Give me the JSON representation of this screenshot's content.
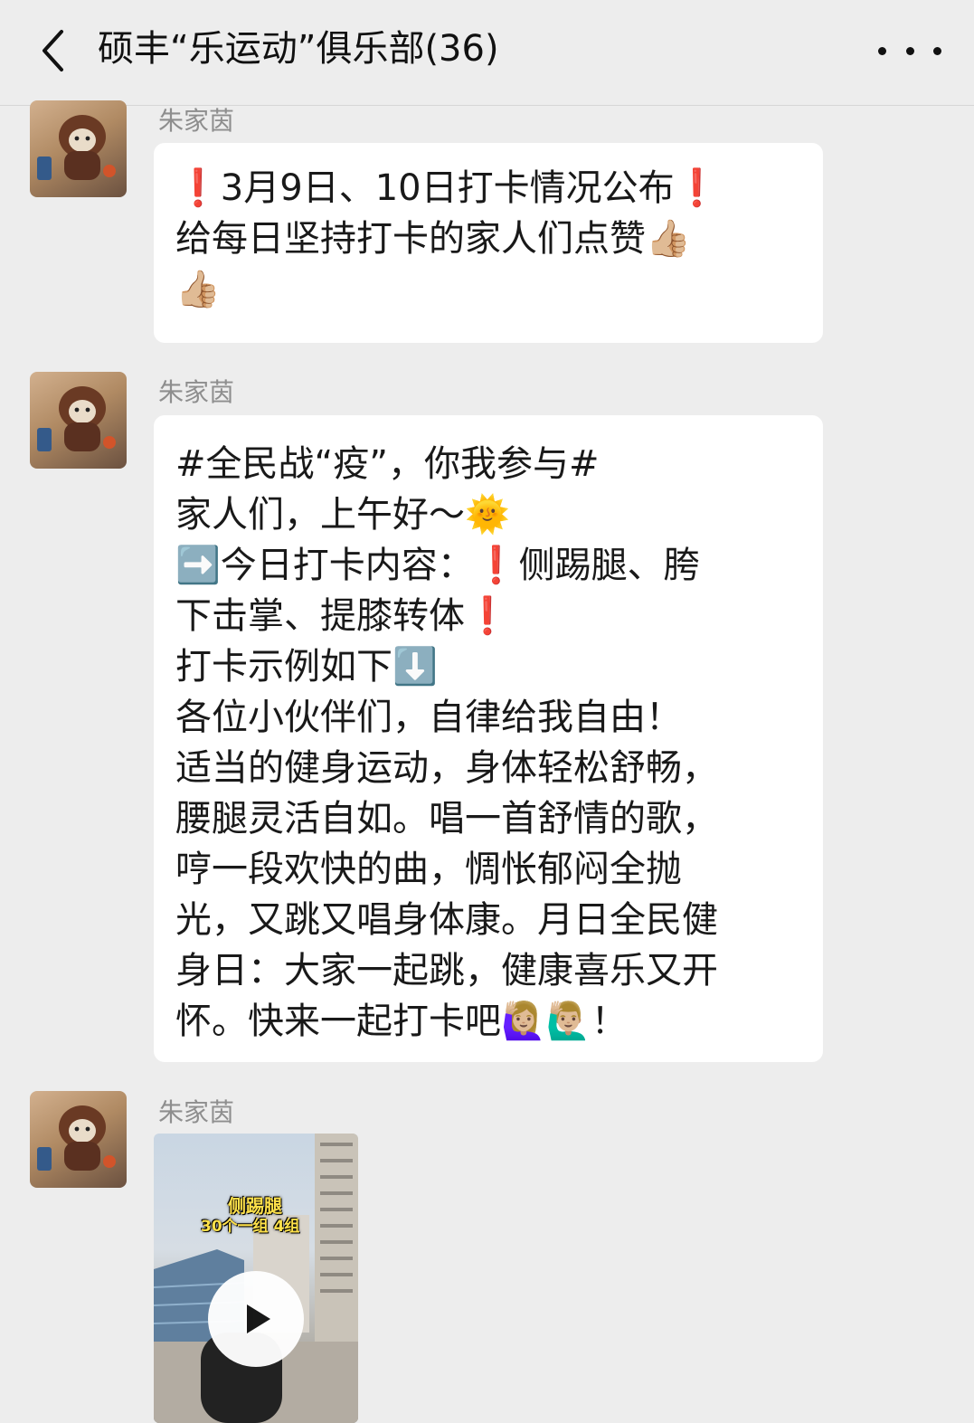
{
  "header": {
    "title": "硕丰“乐运动”俱乐部(36)",
    "back_icon": "chevron-left-icon",
    "more_icon": "more-dots-icon"
  },
  "messages": [
    {
      "sender": "朱家茵",
      "lines": [
        "❗3月9日、10日打卡情况公布❗",
        "给每日坚持打卡的家人们点赞👍🏼",
        "👍🏼"
      ]
    },
    {
      "sender": "朱家茵",
      "lines": [
        "#全民战“疫”，你我参与#",
        "家人们，上午好～🌞",
        "➡️今日打卡内容：❗侧踢腿、胯",
        "下击掌、提膝转体❗",
        "打卡示例如下⬇️",
        "各位小伙伴们，自律给我自由！",
        "适当的健身运动，身体轻松舒畅，",
        "腰腿灵活自如。唱一首舒情的歌，",
        "哼一段欢快的曲，惆怅郁闷全抛",
        "光，又跳又唱身体康。月日全民健",
        "身日：大家一起跳，健康喜乐又开",
        "怀。快来一起打卡吧🙋🏼‍♀️🙋🏼‍♂️！"
      ]
    },
    {
      "sender": "朱家茵",
      "video": {
        "caption_line1": "侧踢腿",
        "caption_line2": "30个一组 4组",
        "play_icon": "play-icon"
      }
    }
  ],
  "colors": {
    "background": "#ededed",
    "bubble": "#ffffff",
    "sender_text": "#8e8e8e"
  }
}
